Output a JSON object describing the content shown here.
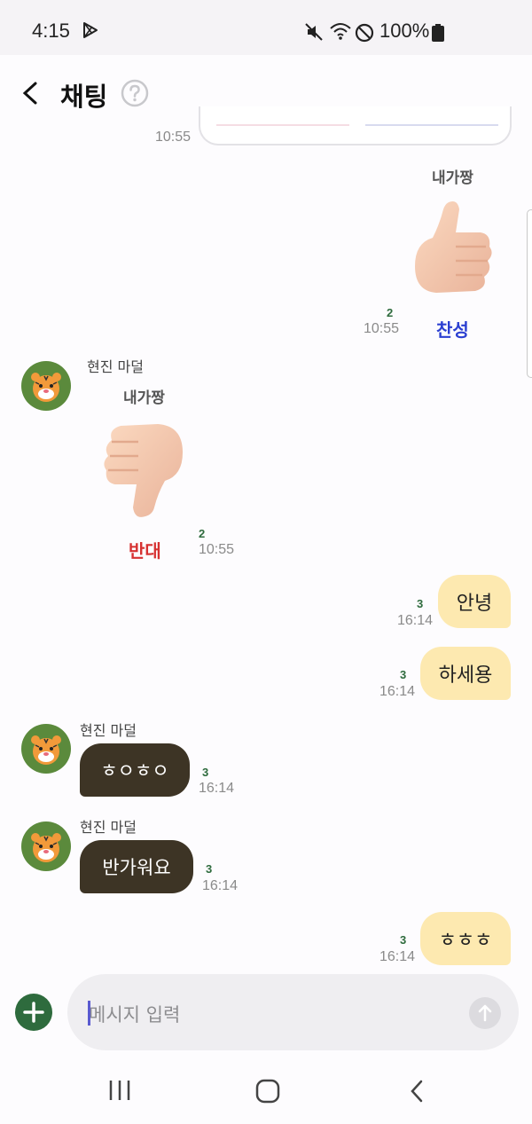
{
  "status_bar": {
    "time": "4:15",
    "battery_percent": "100%"
  },
  "header": {
    "title": "채팅"
  },
  "messages": {
    "prev_card_time": "10:55",
    "vote_mine": {
      "title": "내가짱",
      "label": "찬성",
      "read_count": "2",
      "time": "10:55",
      "label_color": "#2b3fd1"
    },
    "vote_theirs": {
      "sender": "현진 마덜",
      "title": "내가짱",
      "label": "반대",
      "read_count": "2",
      "time": "10:55",
      "label_color": "#d63131"
    },
    "m1": {
      "text": "안녕",
      "read_count": "3",
      "time": "16:14"
    },
    "m2": {
      "text": "하세용",
      "read_count": "3",
      "time": "16:14"
    },
    "m3": {
      "sender": "현진 마덜",
      "text": "ㅎㅇㅎㅇ",
      "read_count": "3",
      "time": "16:14"
    },
    "m4": {
      "sender": "현진 마덜",
      "text": "반가워요",
      "read_count": "3",
      "time": "16:14"
    },
    "m5": {
      "text": "ㅎㅎㅎ",
      "read_count": "3",
      "time": "16:14"
    }
  },
  "input": {
    "placeholder": "메시지 입력"
  },
  "colors": {
    "accent": "#2e6b3d",
    "my_bubble": "#fde9b0",
    "their_bubble": "#3d3425"
  }
}
